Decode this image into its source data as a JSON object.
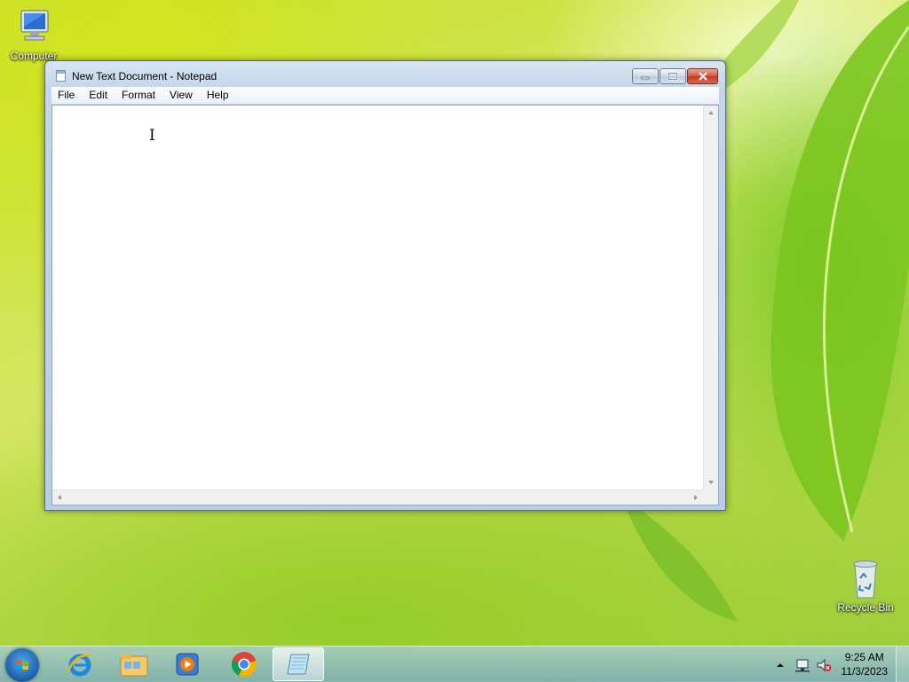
{
  "desktop": {
    "icons": [
      {
        "label": "Computer",
        "icon": "computer-icon"
      },
      {
        "label": "Recycle Bin",
        "icon": "recycle-bin-icon"
      }
    ]
  },
  "window": {
    "title": "New Text Document - Notepad",
    "controls": {
      "minimize": "minimize-icon",
      "maximize": "maximize-icon",
      "close": "close-icon"
    },
    "menu": [
      "File",
      "Edit",
      "Format",
      "View",
      "Help"
    ],
    "content": ""
  },
  "taskbar": {
    "apps": [
      "start-orb",
      "internet-explorer-icon",
      "file-explorer-icon",
      "media-player-icon",
      "chrome-icon",
      "notepad-icon"
    ],
    "active_app": "notepad-icon",
    "tray_icons": [
      "show-hidden-icons-arrow",
      "network-icon",
      "volume-muted-icon"
    ],
    "time": "9:25 AM",
    "date": "11/3/2023"
  },
  "colors": {
    "close_button": "#c23b22",
    "titlebar": "#c4d6ea",
    "taskbar": "#88b4cc"
  }
}
